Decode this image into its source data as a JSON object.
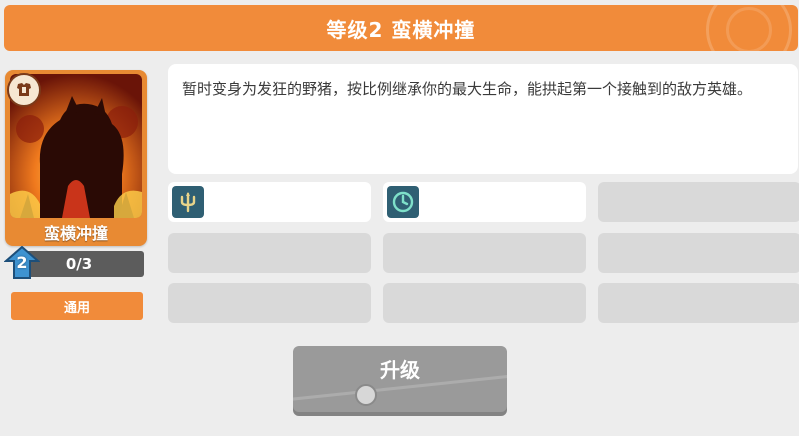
{
  "header": {
    "title": "等级2 蛮横冲撞"
  },
  "skill_card": {
    "name": "蛮横冲撞",
    "type_icon": "armor-icon",
    "art_icon": "boar-silhouette-icon"
  },
  "level": {
    "badge": "2",
    "progress": "0/3"
  },
  "tag_button": {
    "label": "通用"
  },
  "description": {
    "text": "暂时变身为发狂的野猪，按比例继承你的最大生命，能拱起第一个接触到的敌方英雄。"
  },
  "attribute_slots": [
    {
      "icon": "trident-icon",
      "filled": true
    },
    {
      "icon": "clock-icon",
      "filled": true
    },
    {
      "icon": "",
      "filled": false
    },
    {
      "icon": "",
      "filled": false
    },
    {
      "icon": "",
      "filled": false
    },
    {
      "icon": "",
      "filled": false
    },
    {
      "icon": "",
      "filled": false
    },
    {
      "icon": "",
      "filled": false
    },
    {
      "icon": "",
      "filled": false
    }
  ],
  "upgrade_button": {
    "label": "升级",
    "cost_icon": "coin-icon"
  },
  "colors": {
    "accent": "#f18b3a",
    "slot_icon_bg": "#2f5f73",
    "disabled_button": "#9a9a9a"
  }
}
